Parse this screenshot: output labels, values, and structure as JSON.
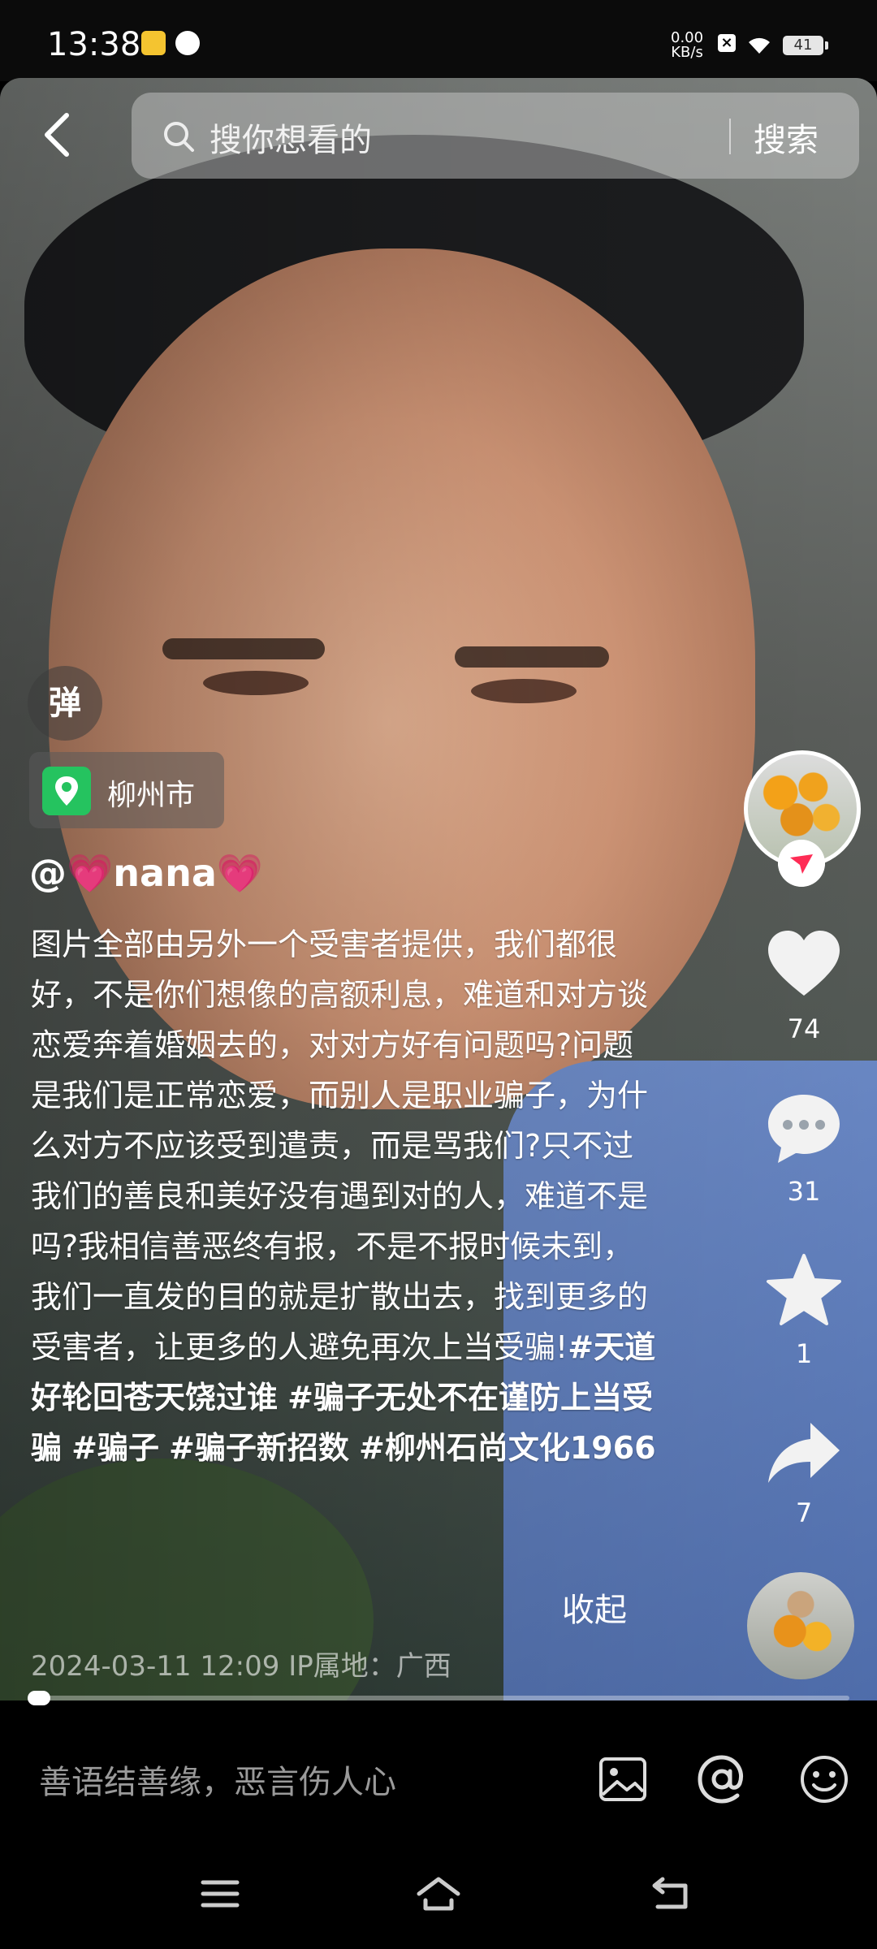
{
  "status_bar": {
    "time": "13:38",
    "net_speed_value": "0.00",
    "net_speed_unit": "KB/s",
    "battery": "41"
  },
  "search": {
    "placeholder": "搜你想看的",
    "button_label": "搜索"
  },
  "post": {
    "danmu_label": "弹",
    "location": "柳州市",
    "author": "@💗nana💗",
    "caption_text": "图片全部由另外一个受害者提供，我们都很好，不是你们想像的高额利息，难道和对方谈恋爱奔着婚姻去的，对对方好有问题吗?问题是我们是正常恋爱，而别人是职业骗子，为什么对方不应该受到遣责，而是骂我们?只不过我们的善良和美好没有遇到对的人，难道不是吗?我相信善恶终有报，不是不报时候未到，我们一直发的目的就是扩散出去，找到更多的受害者，让更多的人避免再次上当受骗!",
    "hashtags": [
      "#天道好轮回苍天饶过谁",
      "#骗子无处不在谨防上当受骗",
      "#骗子",
      "#骗子新招数",
      "#柳州石尚文化1966"
    ],
    "collapse_label": "收起",
    "timestamp": "2024-03-11 12:09  IP属地：广西"
  },
  "actions": {
    "likes": "74",
    "comments": "31",
    "favorites": "1",
    "shares": "7"
  },
  "progress": 0.01,
  "comment_bar": {
    "placeholder": "善语结善缘，恶言伤人心"
  },
  "icons": {
    "back": "chevron-left-icon",
    "search": "magnifier-icon",
    "location": "map-pin-icon",
    "like": "heart-icon",
    "comment": "chat-bubble-icon",
    "favorite": "star-icon",
    "share": "share-arrow-icon",
    "image": "image-icon",
    "mention": "at-icon",
    "emoji": "smiley-icon",
    "nav": [
      "menu-icon",
      "home-icon",
      "back-icon"
    ]
  },
  "colors": {
    "location_pin": "#25c35f",
    "follow_badge": "#fe2c55"
  }
}
